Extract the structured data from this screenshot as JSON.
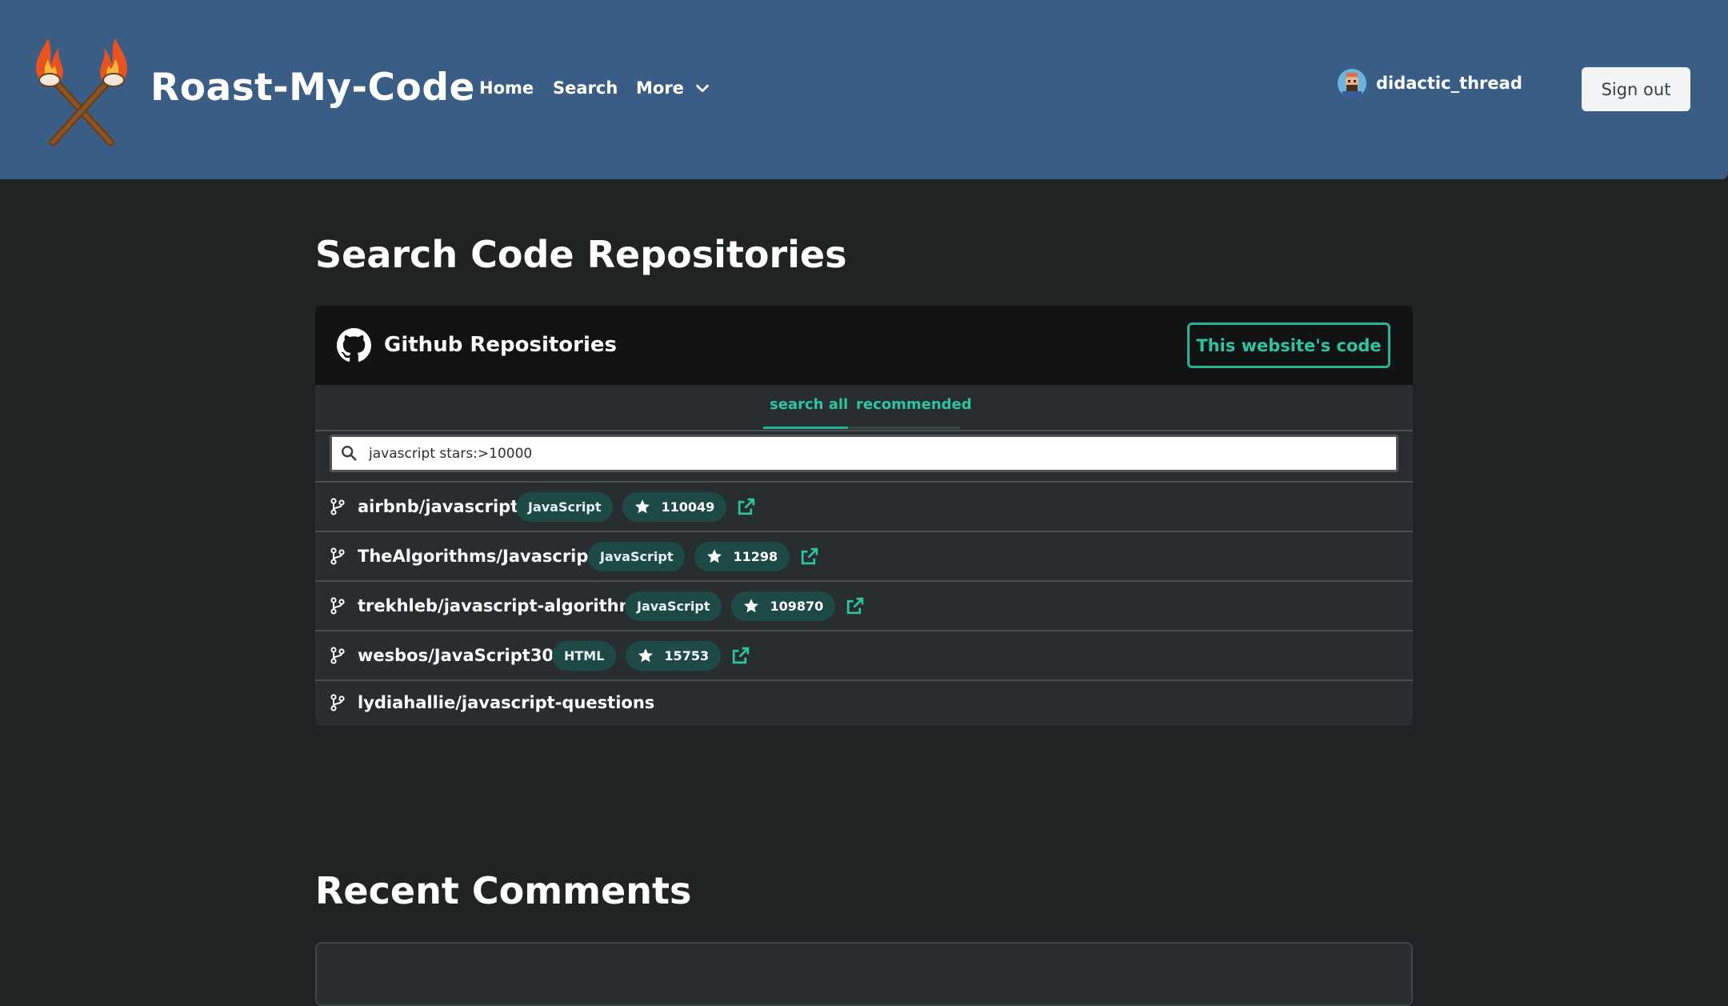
{
  "colors": {
    "header_bg": "#395d84",
    "page_bg": "#1f2324",
    "card_bg": "#282d2f",
    "card_head_bg": "#121313",
    "accent": "#2ec4a2",
    "chip_bg": "#1d4a46"
  },
  "header": {
    "brand": "Roast-My-Code",
    "logo_icon": "crossed-torches-icon",
    "nav": {
      "home": "Home",
      "search": "Search",
      "more": "More"
    },
    "user": {
      "username": "didactic_thread",
      "avatar_icon": "user-avatar-icon"
    },
    "signout_label": "Sign out"
  },
  "search_section": {
    "title": "Search Code Repositories",
    "card_title": "Github Repositories",
    "card_icon": "github-icon",
    "site_code_button": "This website's code",
    "tabs": [
      {
        "label": "search all",
        "active": true
      },
      {
        "label": "recommended",
        "active": false
      }
    ],
    "search": {
      "value": "javascript stars:>10000",
      "icon": "search-icon"
    },
    "results": [
      {
        "name": "airbnb/javascript",
        "language": "JavaScript",
        "stars": "110049"
      },
      {
        "name": "TheAlgorithms/Javascript",
        "language": "JavaScript",
        "stars": "11298"
      },
      {
        "name": "trekhleb/javascript-algorithms",
        "language": "JavaScript",
        "stars": "109870"
      },
      {
        "name": "wesbos/JavaScript30",
        "language": "HTML",
        "stars": "15753"
      },
      {
        "name": "lydiahallie/javascript-questions"
      }
    ]
  },
  "comments_section": {
    "title": "Recent Comments"
  }
}
